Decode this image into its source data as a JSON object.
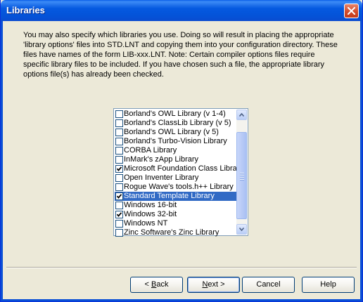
{
  "window": {
    "title": "Libraries"
  },
  "instructions": "You may also specify which libraries you use.  Doing so will result in placing the appropriate 'library options' files into STD.LNT and copying them into your configuration directory.  These files have names of the form LIB-xxx.LNT.  Note: Certain compiler options files require specific library files to be included.  If you have chosen such a file, the appropriate library options file(s) has already been checked.",
  "libraries": [
    {
      "label": "Borland's OWL Library (v 1-4)",
      "checked": false,
      "selected": false
    },
    {
      "label": "Borland's ClassLib Library (v 5)",
      "checked": false,
      "selected": false
    },
    {
      "label": "Borland's OWL Library (v 5)",
      "checked": false,
      "selected": false
    },
    {
      "label": "Borland's Turbo-Vision Library",
      "checked": false,
      "selected": false
    },
    {
      "label": "CORBA Library",
      "checked": false,
      "selected": false
    },
    {
      "label": "InMark's zApp Library",
      "checked": false,
      "selected": false
    },
    {
      "label": "Microsoft Foundation Class Library",
      "checked": true,
      "selected": false
    },
    {
      "label": "Open Inventer Library",
      "checked": false,
      "selected": false
    },
    {
      "label": "Rogue Wave's tools.h++ Library",
      "checked": false,
      "selected": false
    },
    {
      "label": "Standard Template Library",
      "checked": true,
      "selected": true
    },
    {
      "label": "Windows 16-bit",
      "checked": false,
      "selected": false
    },
    {
      "label": "Windows 32-bit",
      "checked": true,
      "selected": false
    },
    {
      "label": "Windows NT",
      "checked": false,
      "selected": false
    },
    {
      "label": "Zinc Software's Zinc Library",
      "checked": false,
      "selected": false
    }
  ],
  "buttons": {
    "back_mnemonic": "B",
    "back_rest": "ack",
    "back_prefix": "< ",
    "next_mnemonic": "N",
    "next_rest": "ext >",
    "cancel": "Cancel",
    "help": "Help"
  },
  "colors": {
    "titlebar": "#0559e0",
    "selection": "#316ac5",
    "dialog_bg": "#ece9d8",
    "close_button": "#d44c2b"
  }
}
